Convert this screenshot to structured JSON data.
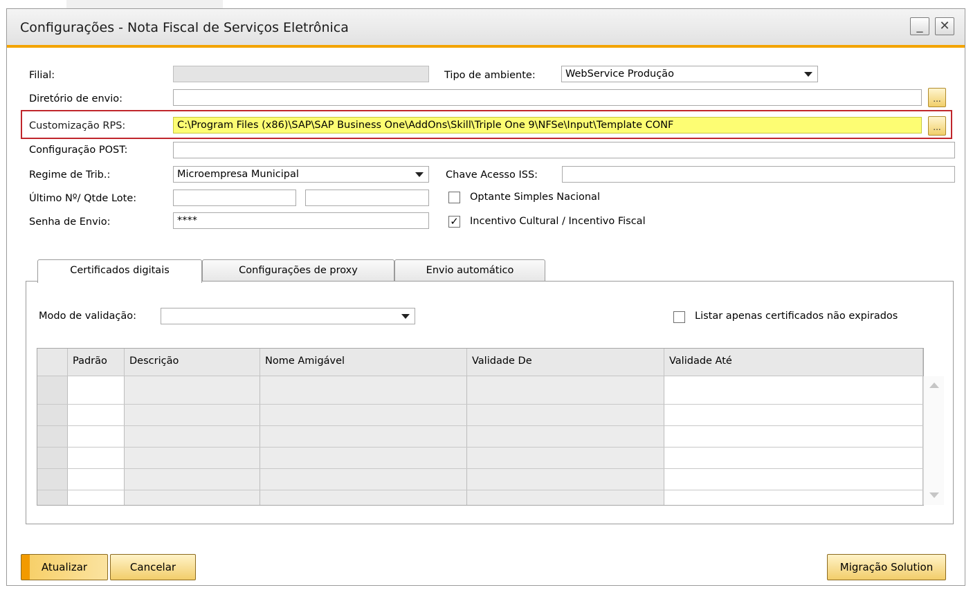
{
  "window": {
    "title": "Configurações - Nota Fiscal de Serviços Eletrônica",
    "minimize_label": "_",
    "close_label": "✕"
  },
  "form": {
    "filial_label": "Filial:",
    "filial_value": "",
    "tipo_ambiente_label": "Tipo de ambiente:",
    "tipo_ambiente_value": "WebService Produção",
    "diretorio_label": "Diretório de envio:",
    "diretorio_value": "",
    "customizacao_label": "Customização RPS:",
    "customizacao_value": "C:\\Program Files (x86)\\SAP\\SAP Business One\\AddOns\\Skill\\Triple One 9\\NFSe\\Input\\Template CONF",
    "config_post_label": "Configuração POST:",
    "config_post_value": "",
    "regime_label": "Regime de Trib.:",
    "regime_value": "Microempresa Municipal",
    "chave_label": "Chave Acesso ISS:",
    "chave_value": "",
    "ultimo_label": "Último Nº/ Qtde  Lote:",
    "ultimo_value": "",
    "qtde_value": "",
    "optante_label": "Optante Simples Nacional",
    "optante_checked": false,
    "senha_label": "Senha de Envio:",
    "senha_value": "****",
    "incentivo_label": "Incentivo Cultural / Incentivo Fiscal",
    "incentivo_checked": true,
    "browse_label": "..."
  },
  "tabs": [
    {
      "label": "Certificados digitais",
      "active": true
    },
    {
      "label": "Configurações de proxy",
      "active": false
    },
    {
      "label": "Envio automático",
      "active": false
    }
  ],
  "certificados": {
    "modo_label": "Modo de validação:",
    "modo_value": "",
    "listar_label": "Listar apenas certificados não expirados",
    "listar_checked": false,
    "columns": [
      "Padrão",
      "Descrição",
      "Nome Amigável",
      "Validade De",
      "Validade Até"
    ],
    "row_count": 6
  },
  "buttons": {
    "atualizar": "Atualizar",
    "cancelar": "Cancelar",
    "migracao": "Migração Solution"
  },
  "colors": {
    "accent": "#f3a400",
    "highlight_field": "#fdfd73",
    "highlight_border": "#c0262b"
  }
}
